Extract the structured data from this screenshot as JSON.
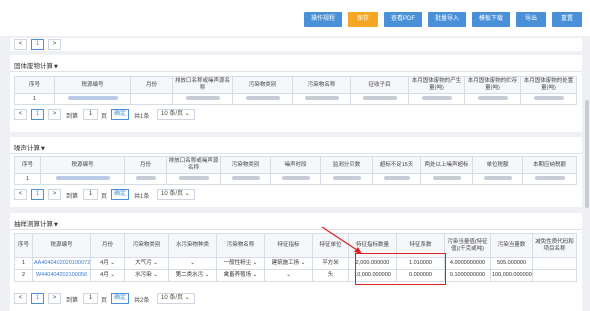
{
  "toolbar": {
    "buttons": [
      "操作规程",
      "保存",
      "查看PDF",
      "批量导入",
      "模板下载",
      "导出",
      "重置"
    ],
    "accent": "#4a90d9",
    "save_color": "#f5a623"
  },
  "solid_waste": {
    "title": "固体废物计算",
    "headers": [
      "序号",
      "税源编号",
      "月份",
      "排放口名称或噪声源名称",
      "污染物类别",
      "污染物名称",
      "征收子目",
      "本月固体废物的产生量(吨)",
      "本月固体废物的贮存量(吨)",
      "本月固体废物的处置量(吨)"
    ],
    "row": {
      "no": "1"
    },
    "pager": {
      "prev": "<",
      "page": "1",
      "next": ">",
      "goto": "到第",
      "page_unit": "页",
      "confirm": "确定",
      "total": "共1条",
      "page_size": "10 条/页"
    }
  },
  "noise": {
    "title": "噪声计算",
    "headers": [
      "序号",
      "税源编号",
      "月份",
      "排放口名称或噪声源名称",
      "污染物类别",
      "噪声时段",
      "监测分贝数",
      "超标不足15天",
      "两处以上噪声超标",
      "单位税额",
      "本期应纳税额"
    ],
    "row": {
      "no": "1"
    },
    "pager": {
      "prev": "<",
      "page": "1",
      "next": ">",
      "goto": "到第",
      "page_unit": "页",
      "confirm": "确定",
      "total": "共1条",
      "page_size": "10 条/页"
    }
  },
  "sampling": {
    "title": "抽样测算计算",
    "headers": [
      "序号",
      "税源编号",
      "月份",
      "污染物类别",
      "水污染物种类",
      "污染物名称",
      "特征指标",
      "特征单位",
      "特征指标数量",
      "特征系数",
      "污染当量值(特征值)(千克或吨)",
      "污染当量数",
      "减免性质代码和项目名称"
    ],
    "rows": [
      {
        "no": "1",
        "source": "AA4040402020100072",
        "month": "4月",
        "category": "大气污",
        "water_type": "",
        "pollutant": "一般性粉尘",
        "indicator": "建筑施工扬",
        "unit": "平方米",
        "quantity": "2,000.000000",
        "coef": "1.010000",
        "equiv_value": "4.0000000000",
        "equiv_count": "505.000000"
      },
      {
        "no": "2",
        "source": "W440404202100058",
        "month": "4月",
        "category": "水污染",
        "water_type": "第二类水污",
        "pollutant": "禽畜养殖场",
        "indicator": "",
        "unit": "头",
        "quantity": "10,000.000000",
        "coef": "0.000000",
        "equiv_value": "0.1000000000",
        "equiv_count": "100,000.000000"
      }
    ],
    "pager": {
      "prev": "<",
      "page": "1",
      "next": ">",
      "goto": "到第",
      "page_unit": "页",
      "confirm": "确定",
      "total": "共2条",
      "page_size": "10 条/页"
    }
  }
}
